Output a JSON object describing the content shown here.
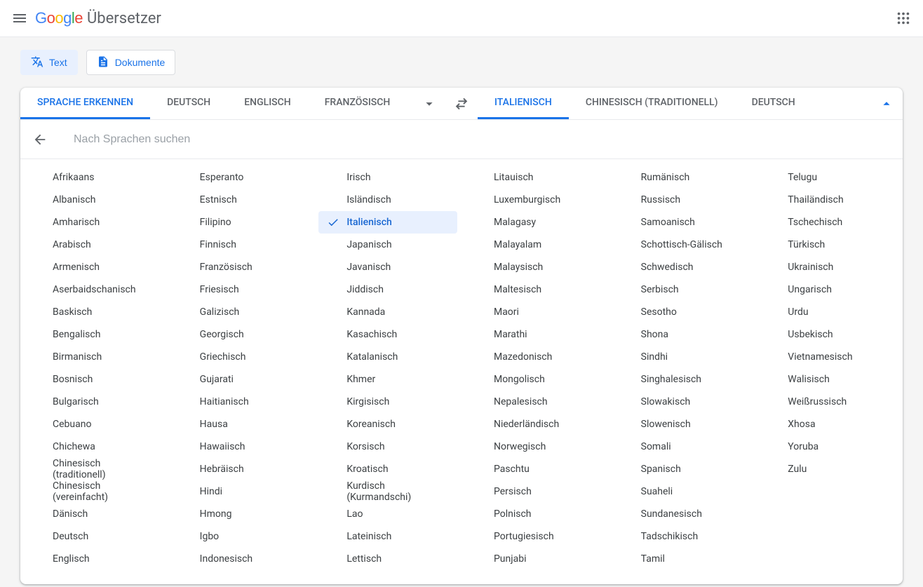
{
  "app": {
    "brand": "Google",
    "product": "Übersetzer"
  },
  "modes": {
    "text": "Text",
    "documents": "Dokumente"
  },
  "sourceTabs": [
    "SPRACHE ERKENNEN",
    "DEUTSCH",
    "ENGLISCH",
    "FRANZÖSISCH"
  ],
  "sourceActiveIndex": 0,
  "targetTabs": [
    "ITALIENISCH",
    "CHINESISCH (TRADITIONELL)",
    "DEUTSCH"
  ],
  "targetActiveIndex": 0,
  "search": {
    "placeholder": "Nach Sprachen suchen",
    "value": ""
  },
  "selectedLanguage": "Italienisch",
  "languages": [
    "Afrikaans",
    "Albanisch",
    "Amharisch",
    "Arabisch",
    "Armenisch",
    "Aserbaidschanisch",
    "Baskisch",
    "Bengalisch",
    "Birmanisch",
    "Bosnisch",
    "Bulgarisch",
    "Cebuano",
    "Chichewa",
    "Chinesisch (traditionell)",
    "Chinesisch (vereinfacht)",
    "Dänisch",
    "Deutsch",
    "Englisch",
    "Esperanto",
    "Estnisch",
    "Filipino",
    "Finnisch",
    "Französisch",
    "Friesisch",
    "Galizisch",
    "Georgisch",
    "Griechisch",
    "Gujarati",
    "Haitianisch",
    "Hausa",
    "Hawaiisch",
    "Hebräisch",
    "Hindi",
    "Hmong",
    "Igbo",
    "Indonesisch",
    "Irisch",
    "Isländisch",
    "Italienisch",
    "Japanisch",
    "Javanisch",
    "Jiddisch",
    "Kannada",
    "Kasachisch",
    "Katalanisch",
    "Khmer",
    "Kirgisisch",
    "Koreanisch",
    "Korsisch",
    "Kroatisch",
    "Kurdisch (Kurmandschi)",
    "Lao",
    "Lateinisch",
    "Lettisch",
    "Litauisch",
    "Luxemburgisch",
    "Malagasy",
    "Malayalam",
    "Malaysisch",
    "Maltesisch",
    "Maori",
    "Marathi",
    "Mazedonisch",
    "Mongolisch",
    "Nepalesisch",
    "Niederländisch",
    "Norwegisch",
    "Paschtu",
    "Persisch",
    "Polnisch",
    "Portugiesisch",
    "Punjabi",
    "Rumänisch",
    "Russisch",
    "Samoanisch",
    "Schottisch-Gälisch",
    "Schwedisch",
    "Serbisch",
    "Sesotho",
    "Shona",
    "Sindhi",
    "Singhalesisch",
    "Slowakisch",
    "Slowenisch",
    "Somali",
    "Spanisch",
    "Suaheli",
    "Sundanesisch",
    "Tadschikisch",
    "Tamil",
    "Telugu",
    "Thailändisch",
    "Tschechisch",
    "Türkisch",
    "Ukrainisch",
    "Ungarisch",
    "Urdu",
    "Usbekisch",
    "Vietnamesisch",
    "Walisisch",
    "Weißrussisch",
    "Xhosa",
    "Yoruba",
    "Zulu"
  ]
}
